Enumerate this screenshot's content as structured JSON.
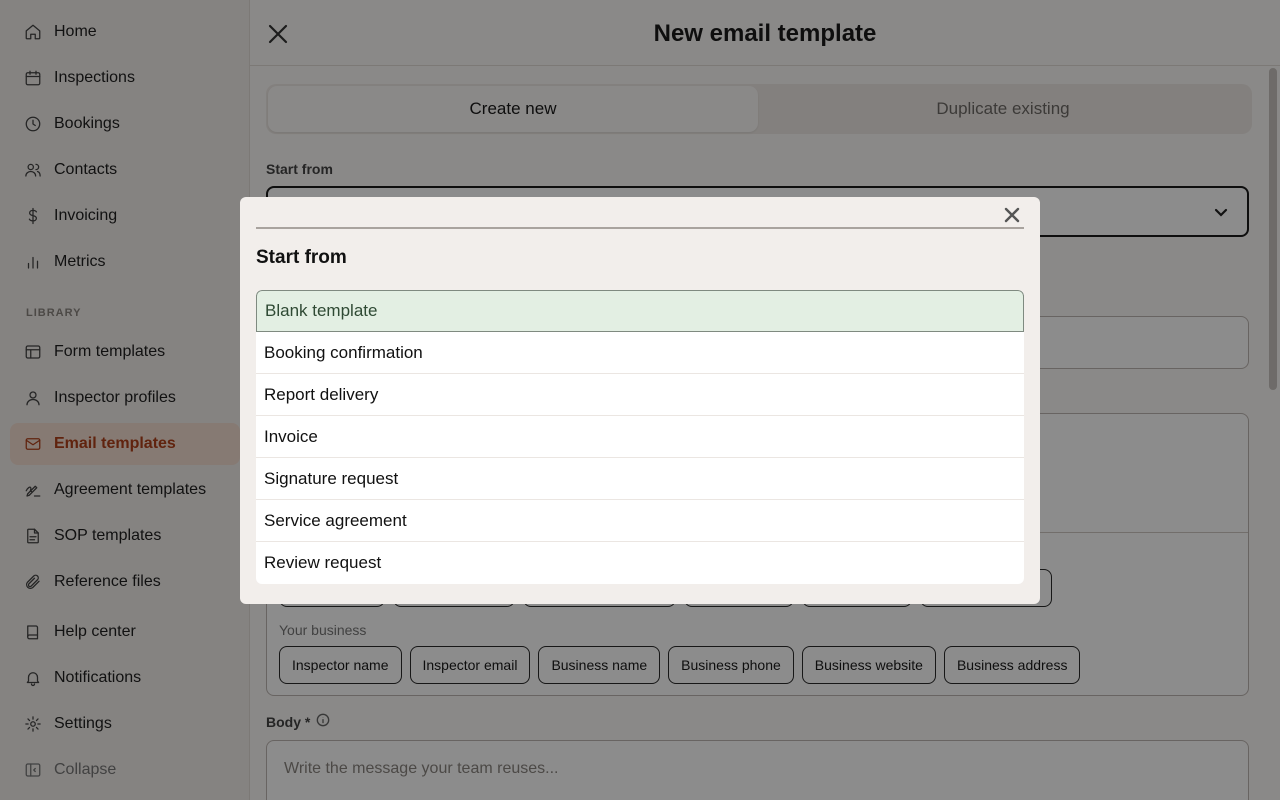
{
  "sidebar": {
    "items": [
      {
        "label": "Home",
        "icon": "home-icon"
      },
      {
        "label": "Inspections",
        "icon": "calendar-icon"
      },
      {
        "label": "Bookings",
        "icon": "clock-icon"
      },
      {
        "label": "Contacts",
        "icon": "users-icon"
      },
      {
        "label": "Invoicing",
        "icon": "dollar-icon"
      },
      {
        "label": "Metrics",
        "icon": "bar-chart-icon"
      }
    ],
    "library_label": "LIBRARY",
    "library_items": [
      {
        "label": "Form templates",
        "icon": "layout-icon"
      },
      {
        "label": "Inspector profiles",
        "icon": "user-icon"
      },
      {
        "label": "Email templates",
        "icon": "mail-icon",
        "active": true
      },
      {
        "label": "Agreement templates",
        "icon": "signature-icon"
      },
      {
        "label": "SOP templates",
        "icon": "file-text-icon"
      },
      {
        "label": "Reference files",
        "icon": "paperclip-icon"
      }
    ],
    "footer_items": [
      {
        "label": "Help center",
        "icon": "book-icon"
      },
      {
        "label": "Notifications",
        "icon": "bell-icon"
      },
      {
        "label": "Settings",
        "icon": "gear-icon"
      },
      {
        "label": "Collapse",
        "icon": "sidebar-collapse-icon"
      }
    ]
  },
  "main": {
    "title": "New email template",
    "tabs": [
      {
        "label": "Create new",
        "active": true
      },
      {
        "label": "Duplicate existing",
        "active": false
      }
    ],
    "start_from_label": "Start from",
    "your_business_label": "Your business",
    "business_chips": [
      "Inspector name",
      "Inspector email",
      "Business name",
      "Business phone",
      "Business website",
      "Business address"
    ],
    "body_label": "Body *",
    "body_placeholder": "Write the message your team reuses..."
  },
  "modal": {
    "title": "Start from",
    "options": [
      {
        "label": "Blank template",
        "selected": true
      },
      {
        "label": "Booking confirmation"
      },
      {
        "label": "Report delivery"
      },
      {
        "label": "Invoice"
      },
      {
        "label": "Signature request"
      },
      {
        "label": "Service agreement"
      },
      {
        "label": "Review request"
      }
    ]
  },
  "colors": {
    "accent": "#b0411a",
    "active_bg": "#f5dfd2",
    "selected_option_bg": "#e3efe3",
    "overlay": "rgba(0,0,0,0.45)"
  }
}
